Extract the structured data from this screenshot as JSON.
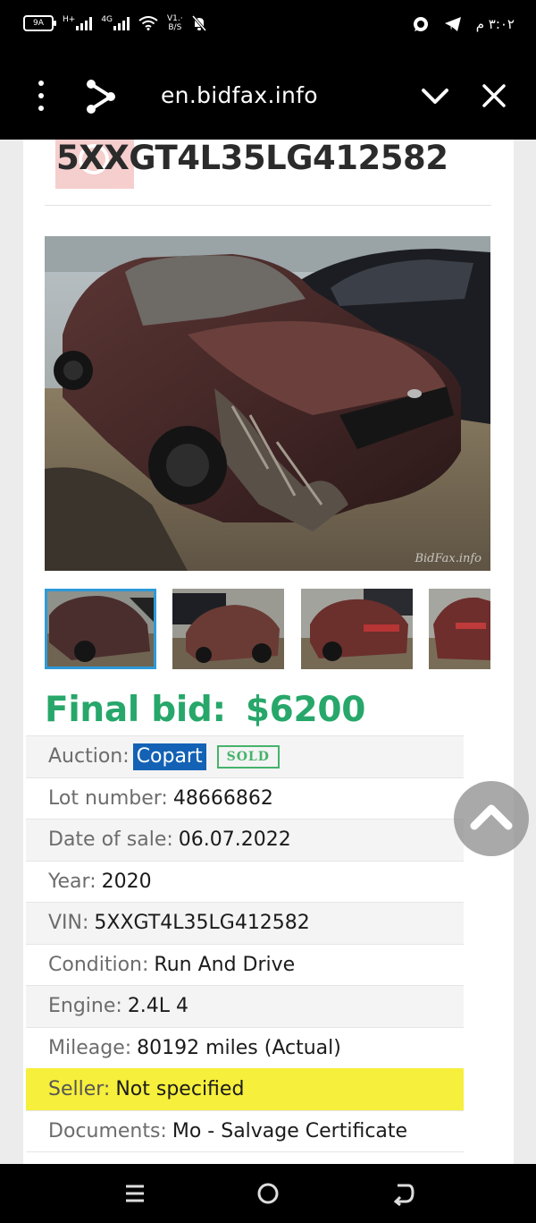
{
  "status_bar": {
    "battery_level": "9A",
    "network_a": "H+",
    "network_b": "4G",
    "data_speed": "V1.·",
    "data_unit": "B/S",
    "time": "٣:٠٢ م"
  },
  "browser": {
    "url": "en.bidfax.info",
    "icons": [
      "menu-dots-icon",
      "share-icon",
      "chevron-down-icon",
      "close-icon"
    ]
  },
  "listing": {
    "vin_title": "5XXGT4L35LG412582",
    "photo_watermark": "BidFax.info",
    "thumbnail_count": 4,
    "final_bid_label": "Final bid:",
    "final_bid_value": "$6200",
    "auction": {
      "label": "Auction:",
      "value": "Copart",
      "status": "SOLD"
    },
    "details": [
      {
        "label": "Lot number:",
        "value": "48666862"
      },
      {
        "label": "Date of sale:",
        "value": "06.07.2022"
      },
      {
        "label": "Year:",
        "value": "2020"
      },
      {
        "label": "VIN:",
        "value": "5XXGT4L35LG412582"
      },
      {
        "label": "Condition:",
        "value": "Run And Drive"
      },
      {
        "label": "Engine:",
        "value": "2.4L 4"
      },
      {
        "label": "Mileage:",
        "value": "80192 miles (Actual)"
      },
      {
        "label": "Seller:",
        "value": "Not specified"
      },
      {
        "label": "Documents:",
        "value": "Mo - Salvage Certificate"
      }
    ]
  },
  "colors": {
    "final_bid": "#27a76a",
    "copart_badge": "#1362b5",
    "sold_badge": "#45b36b",
    "seller_highlight": "#f6ef3b",
    "thumbnail_selected": "#2e9ad8"
  },
  "nav_bar": {
    "icons": [
      "recent-apps-icon",
      "home-icon",
      "back-icon"
    ]
  }
}
